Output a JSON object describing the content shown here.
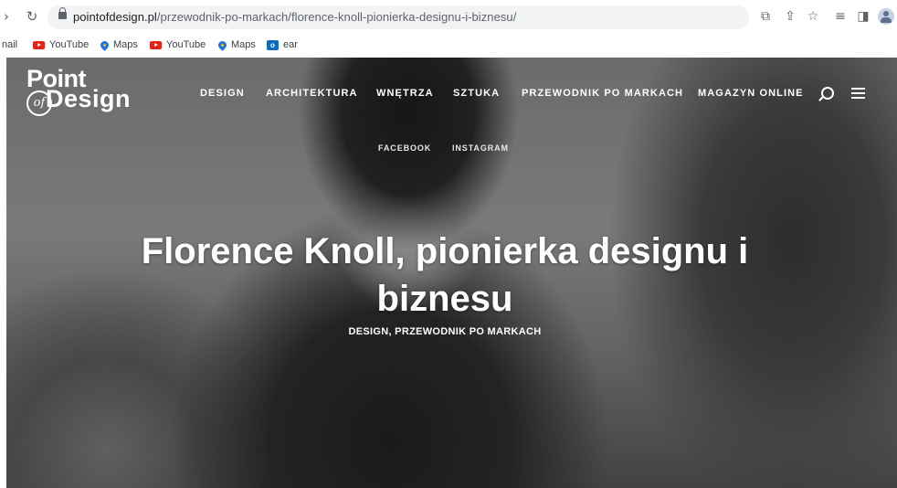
{
  "browser": {
    "url_host": "pointofdesign.pl",
    "url_path": "/przewodnik-po-markach/florence-knoll-pionierka-designu-i-biznesu/"
  },
  "bookmarks": [
    {
      "label": "nail",
      "icon": "partial-bookmark"
    },
    {
      "label": "YouTube",
      "icon": "youtube-icon"
    },
    {
      "label": "Maps",
      "icon": "maps-icon"
    },
    {
      "label": "YouTube",
      "icon": "youtube-icon"
    },
    {
      "label": "Maps",
      "icon": "maps-icon"
    },
    {
      "label": "ear",
      "icon": "outlook-icon"
    }
  ],
  "site": {
    "logo_line1": "Point",
    "logo_of": "of",
    "logo_line2": "Design",
    "nav": [
      "DESIGN",
      "ARCHITEKTURA",
      "WNĘTRZA",
      "SZTUKA",
      "PRZEWODNIK PO MARKACH",
      "MAGAZYN ONLINE"
    ],
    "social": [
      "FACEBOOK",
      "INSTAGRAM"
    ]
  },
  "article": {
    "title": "Florence Knoll, pionierka designu i biznesu",
    "categories": "DESIGN, PRZEWODNIK PO MARKACH"
  },
  "colors": {
    "chrome_bg": "#ffffff",
    "omnibox": "#f1f3f4",
    "hero_text": "#ffffff"
  }
}
